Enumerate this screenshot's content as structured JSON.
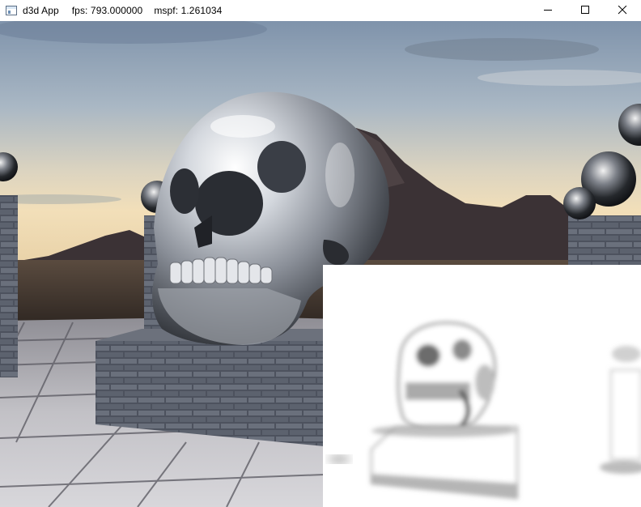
{
  "window": {
    "app_title": "d3d App",
    "fps_label": "fps: 793.000000",
    "mspf_label": "mspf: 1.261034",
    "icons": {
      "app": "app-window-icon",
      "minimize": "minimize-icon",
      "maximize": "maximize-icon",
      "close": "close-icon"
    }
  },
  "scene": {
    "sky_top": "#8fa3b8",
    "sky_horizon": "#f0e2c4",
    "mountain": "#3d3336",
    "ground": "#4a3f36",
    "floor_tile": "#c9c7c9",
    "brick": "#4b505c",
    "chrome": "#b9bdc3"
  },
  "debug_view": {
    "background": "#ffffff",
    "occlusion": "#7a7a7a"
  }
}
